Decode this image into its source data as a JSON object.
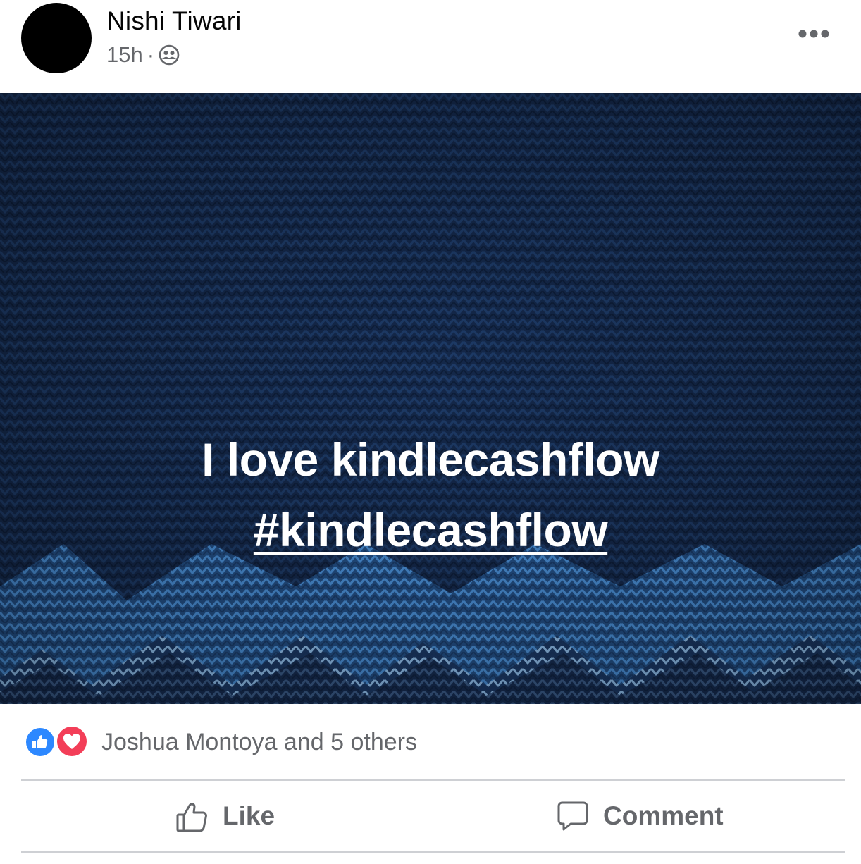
{
  "post": {
    "author_name": "Nishi Tiwari",
    "timestamp": "15h",
    "separator": "·",
    "audience_icon": "friends-icon",
    "more_icon": "more-horizontal-icon"
  },
  "media": {
    "caption_line1": "I love kindlecashflow",
    "hashtag": "#kindlecashflow",
    "background": "knit-sweater-navy-blue"
  },
  "reactions": {
    "icons": [
      "like-reaction-icon",
      "love-reaction-icon"
    ],
    "summary": "Joshua Montoya and 5 others"
  },
  "actions": {
    "like_label": "Like",
    "comment_label": "Comment"
  },
  "colors": {
    "text_primary": "#050505",
    "text_secondary": "#65676b",
    "like_blue": "#2d88ff",
    "love_red": "#f33e58",
    "divider": "#ced0d4",
    "media_bg": "#132848"
  }
}
